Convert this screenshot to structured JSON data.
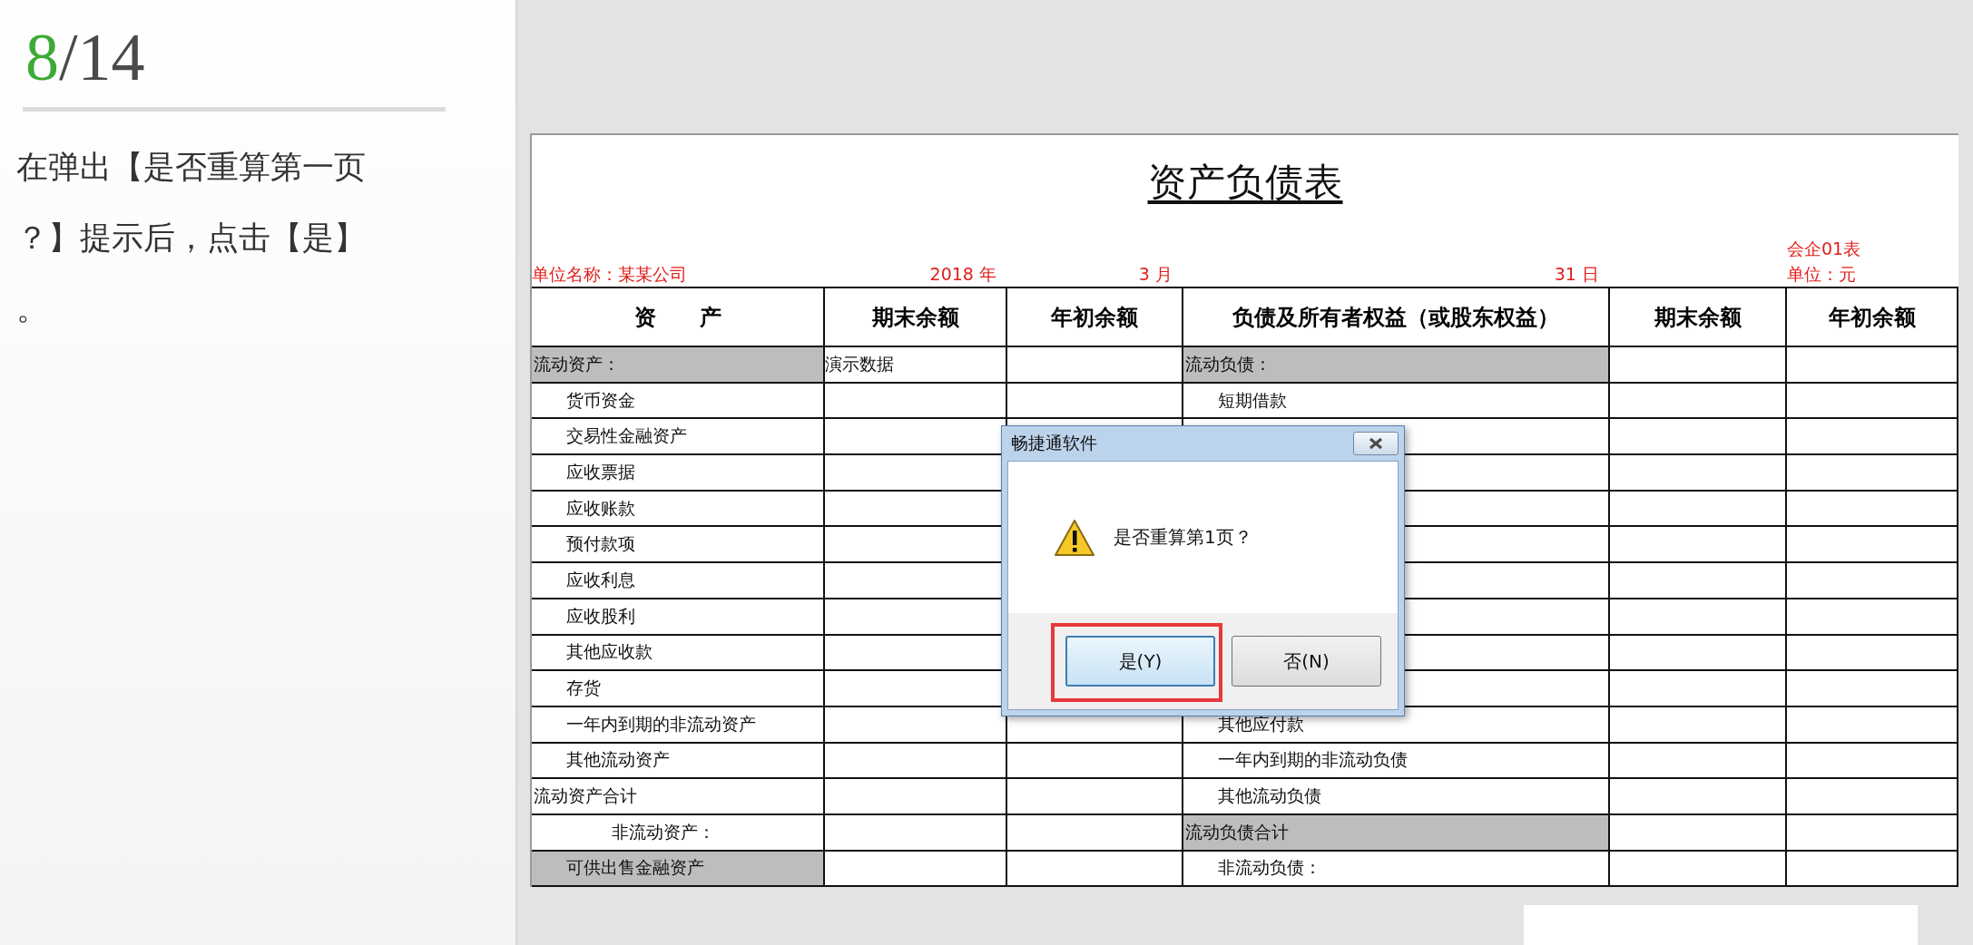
{
  "slide": {
    "page_current": "8",
    "page_total": "/14",
    "instruction": "在弹出【是否重算第一页？】提示后，点击【是】。"
  },
  "sheet": {
    "title": "资产负债表",
    "form_code": "会企01表",
    "company": "单位名称：某某公司",
    "year": "2018 年",
    "month": "3 月",
    "day": "31 日",
    "unit": "单位：元",
    "demo_label": "演示数据",
    "columns": [
      "资　　产",
      "期末余额",
      "年初余额",
      "负债及所有者权益（或股东权益）",
      "期末余额",
      "年初余额"
    ],
    "rows": [
      {
        "asset": {
          "text": "流动资产：",
          "kind": "section",
          "shaded": true
        },
        "liability": {
          "text": "流动负债：",
          "kind": "section",
          "shaded": true
        }
      },
      {
        "asset": {
          "text": "货币资金",
          "kind": "item",
          "shaded": false
        },
        "liability": {
          "text": "短期借款",
          "kind": "item",
          "shaded": false
        }
      },
      {
        "asset": {
          "text": "交易性金融资产",
          "kind": "item",
          "shaded": false
        }
      },
      {
        "asset": {
          "text": "应收票据",
          "kind": "item",
          "shaded": false
        }
      },
      {
        "asset": {
          "text": "应收账款",
          "kind": "item",
          "shaded": false
        }
      },
      {
        "asset": {
          "text": "预付款项",
          "kind": "item",
          "shaded": false
        }
      },
      {
        "asset": {
          "text": "应收利息",
          "kind": "item",
          "shaded": false
        }
      },
      {
        "asset": {
          "text": "应收股利",
          "kind": "item",
          "shaded": false
        }
      },
      {
        "asset": {
          "text": "其他应收款",
          "kind": "item",
          "shaded": false
        }
      },
      {
        "asset": {
          "text": "存货",
          "kind": "item",
          "shaded": false
        }
      },
      {
        "asset": {
          "text": "一年内到期的非流动资产",
          "kind": "item",
          "shaded": false
        },
        "liability": {
          "text": "其他应付款",
          "kind": "item",
          "shaded": false
        }
      },
      {
        "asset": {
          "text": "其他流动资产",
          "kind": "item",
          "shaded": false
        },
        "liability": {
          "text": "一年内到期的非流动负债",
          "kind": "item",
          "shaded": false
        }
      },
      {
        "asset": {
          "text": "流动资产合计",
          "kind": "total",
          "shaded": false
        },
        "liability": {
          "text": "其他流动负债",
          "kind": "item",
          "shaded": false
        }
      },
      {
        "asset": {
          "text": "非流动资产：",
          "kind": "subsection",
          "shaded": false
        },
        "liability": {
          "text": "流动负债合计",
          "kind": "total",
          "shaded": true
        }
      },
      {
        "asset": {
          "text": "可供出售金融资产",
          "kind": "item",
          "shaded": true
        },
        "liability": {
          "text": "非流动负债：",
          "kind": "item",
          "shaded": false
        }
      }
    ]
  },
  "dialog": {
    "title": "畅捷通软件",
    "message": "是否重算第1页？",
    "buttons": [
      {
        "label": "是(Y)",
        "highlighted": true
      },
      {
        "label": "否(N)",
        "highlighted": false
      }
    ]
  }
}
